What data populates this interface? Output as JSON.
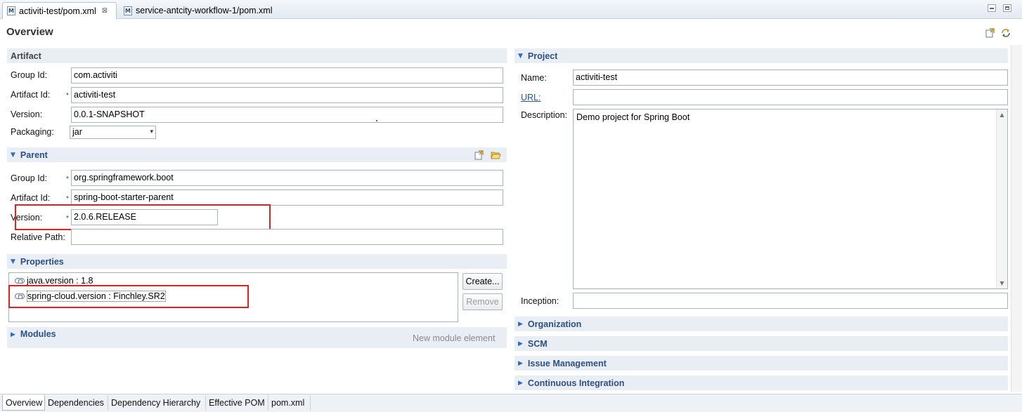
{
  "editor_tabs": [
    {
      "label": "activiti-test/pom.xml",
      "close": "⊠",
      "active": true
    },
    {
      "label": "service-antcity-workflow-1/pom.xml",
      "active": false
    }
  ],
  "file_icon_letter": "M",
  "page_title": "Overview",
  "artifact": {
    "header": "Artifact",
    "group_id_label": "Group Id:",
    "group_id": "com.activiti",
    "artifact_id_label": "Artifact Id:",
    "artifact_id": "activiti-test",
    "version_label": "Version:",
    "version": "0.0.1-SNAPSHOT",
    "packaging_label": "Packaging:",
    "packaging": "jar"
  },
  "required_marker": "*",
  "parent": {
    "header": "Parent",
    "group_id_label": "Group Id:",
    "group_id": "org.springframework.boot",
    "artifact_id_label": "Artifact Id:",
    "artifact_id": "spring-boot-starter-parent",
    "version_label": "Version:",
    "version": "2.0.6.RELEASE",
    "relative_path_label": "Relative Path:",
    "relative_path": ""
  },
  "properties": {
    "header": "Properties",
    "items": [
      "java.version : 1.8",
      "spring-cloud.version : Finchley.SR2"
    ],
    "create_label": "Create...",
    "remove_label": "Remove"
  },
  "modules": {
    "header": "Modules",
    "hint": "New module element"
  },
  "project": {
    "header": "Project",
    "name_label": "Name:",
    "name": "activiti-test",
    "url_label": "URL:",
    "url": "",
    "description_label": "Description:",
    "description": "Demo project for Spring Boot",
    "inception_label": "Inception:",
    "inception": ""
  },
  "collapsed_sections": [
    "Organization",
    "SCM",
    "Issue Management",
    "Continuous Integration"
  ],
  "bottom_tabs": [
    "Overview",
    "Dependencies",
    "Dependency Hierarchy",
    "Effective POM",
    "pom.xml"
  ],
  "glyphs": {
    "expanded": "▼",
    "collapsed": "▶",
    "dropdown": "▾",
    "scroll_up": "▲",
    "scroll_down": "▼"
  },
  "colors": {
    "section_bg": "#e9eef4",
    "section_text": "#2d4f86",
    "highlight": "#e52020",
    "link": "#1f57b8"
  }
}
